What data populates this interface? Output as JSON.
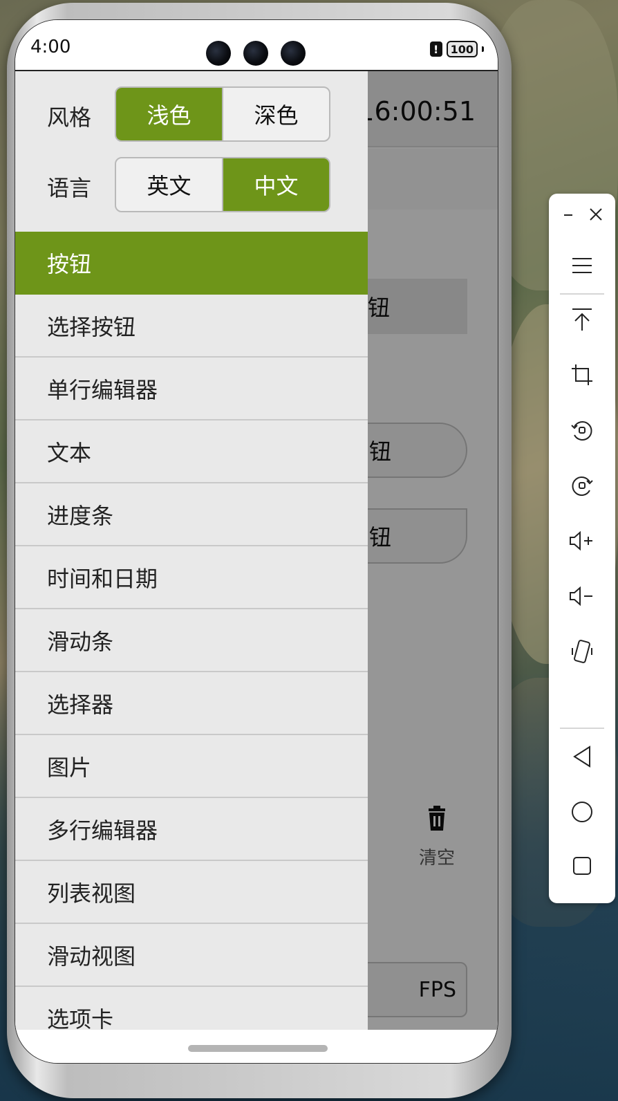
{
  "status_bar": {
    "time": "4:00",
    "alert_glyph": "!",
    "battery": "100"
  },
  "app": {
    "clock": "16:00:51",
    "button_partial_1": "钮",
    "button_partial_2": "钮",
    "button_partial_3": "钮",
    "clear_label": "清空",
    "fps_label": "FPS"
  },
  "drawer": {
    "style_label": "风格",
    "style_options": [
      "浅色",
      "深色"
    ],
    "style_selected": "浅色",
    "language_label": "语言",
    "language_options": [
      "英文",
      "中文"
    ],
    "language_selected": "中文",
    "menu_items": [
      "按钮",
      "选择按钮",
      "单行编辑器",
      "文本",
      "进度条",
      "时间和日期",
      "滑动条",
      "选择器",
      "图片",
      "多行编辑器",
      "列表视图",
      "滑动视图",
      "选项卡"
    ],
    "menu_selected": "按钮"
  },
  "toolbar": {
    "icons": [
      "minimize-icon",
      "close-icon",
      "menu-icon",
      "pin-top-icon",
      "crop-icon",
      "rotate-left-icon",
      "rotate-right-icon",
      "volume-up-icon",
      "volume-down-icon",
      "shake-icon",
      "back-icon",
      "home-icon",
      "recents-icon"
    ]
  },
  "colors": {
    "accent": "#6e9519",
    "drawer_bg": "#e9e9e9",
    "divider": "#c9c9c9"
  }
}
